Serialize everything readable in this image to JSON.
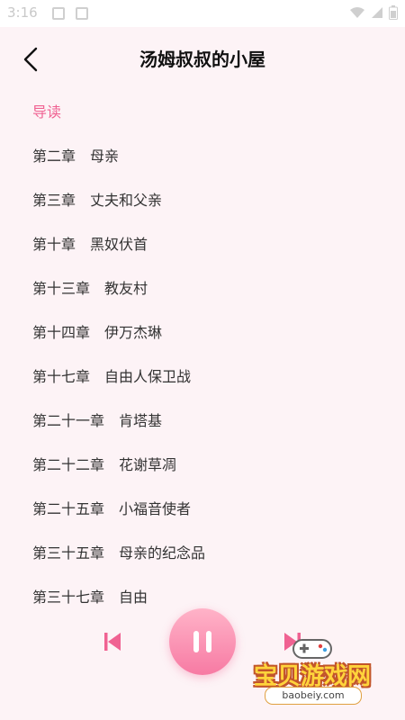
{
  "status": {
    "time": "3:16"
  },
  "appbar": {
    "title": "汤姆叔叔的小屋"
  },
  "chapters": [
    {
      "label": "导读",
      "active": true
    },
    {
      "label": "第二章　母亲"
    },
    {
      "label": "第三章　丈夫和父亲"
    },
    {
      "label": "第十章　黑奴伏首"
    },
    {
      "label": "第十三章　教友村"
    },
    {
      "label": "第十四章　伊万杰琳"
    },
    {
      "label": "第十七章　自由人保卫战"
    },
    {
      "label": "第二十一章　肯塔基"
    },
    {
      "label": "第二十二章　花谢草凋"
    },
    {
      "label": "第二十五章　小福音使者"
    },
    {
      "label": "第三十五章　母亲的纪念品"
    },
    {
      "label": "第三十七章　自由"
    }
  ],
  "player": {
    "state": "playing",
    "accent": "#f06292"
  },
  "watermark": {
    "name": "宝贝游戏网",
    "url": "baobeiy.com"
  },
  "icons": [
    "back-arrow-icon",
    "skip-previous-icon",
    "pause-icon",
    "skip-next-icon",
    "wifi-icon",
    "signal-icon",
    "battery-icon"
  ]
}
